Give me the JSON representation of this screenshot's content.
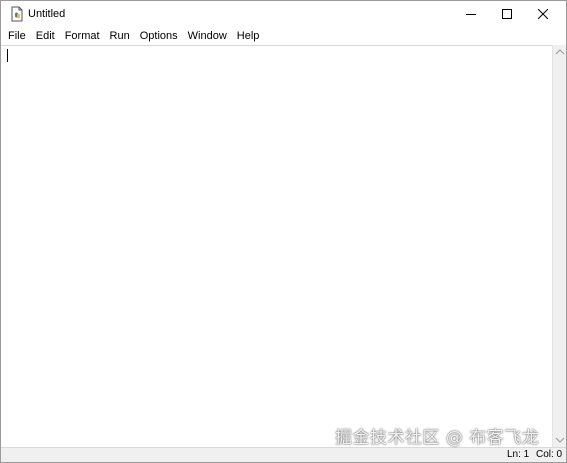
{
  "window": {
    "title": "Untitled"
  },
  "icons": {
    "app": "python-idle-file-icon",
    "minimize": "minimize-icon",
    "maximize": "maximize-icon",
    "close": "close-icon",
    "scroll_up": "scroll-up-arrow-icon",
    "scroll_down": "scroll-down-arrow-icon"
  },
  "menubar": {
    "items": [
      {
        "label": "File"
      },
      {
        "label": "Edit"
      },
      {
        "label": "Format"
      },
      {
        "label": "Run"
      },
      {
        "label": "Options"
      },
      {
        "label": "Window"
      },
      {
        "label": "Help"
      }
    ]
  },
  "editor": {
    "content": ""
  },
  "statusbar": {
    "line": "Ln: 1",
    "column": "Col: 0"
  },
  "watermark": {
    "text": "掘金技术社区 @ 布客飞龙"
  },
  "colors": {
    "window_bg": "#ffffff",
    "scrollbar_bg": "#f0f0f0",
    "statusbar_bg": "#f0f0f0",
    "border": "#9a9a9a"
  }
}
